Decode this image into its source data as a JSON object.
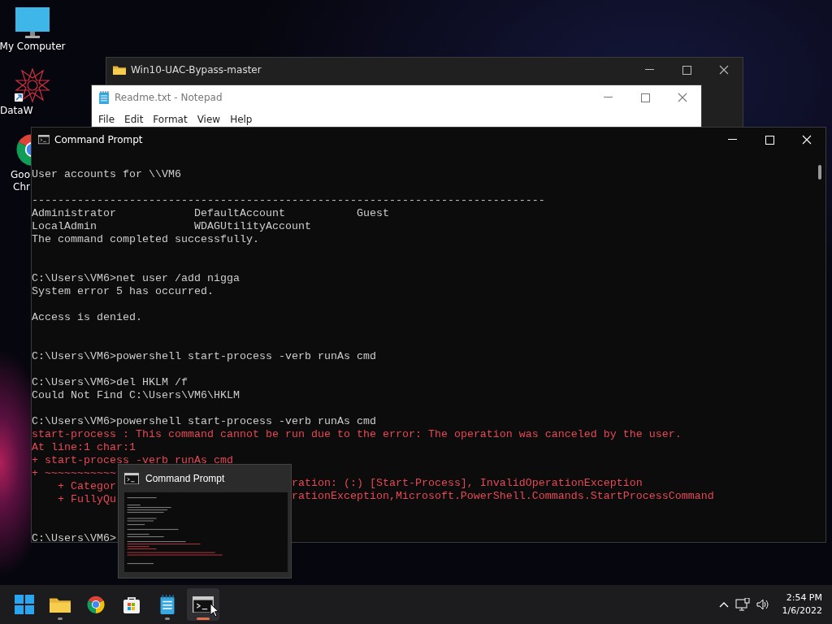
{
  "desktop_icons": [
    {
      "kind": "computer",
      "lines": [
        "My Computer"
      ]
    },
    {
      "kind": "star",
      "lines": [
        "DataW"
      ]
    },
    {
      "kind": "chrome",
      "lines": [
        "Goo",
        "Chr"
      ]
    }
  ],
  "explorer_window": {
    "title": "Win10-UAC-Bypass-master"
  },
  "notepad_window": {
    "title": "Readme.txt - Notepad",
    "menu": [
      "File",
      "Edit",
      "Format",
      "View",
      "Help"
    ]
  },
  "console_window": {
    "title": "Command Prompt",
    "lines": [
      {
        "kind": "normal",
        "segments": [
          "User accounts for \\\\VM6"
        ]
      },
      {
        "kind": "blank"
      },
      {
        "kind": "normal",
        "segments": [
          "-------------------------------------------------------------------------------"
        ]
      },
      {
        "kind": "normal",
        "segments": [
          "Administrator            DefaultAccount           Guest"
        ]
      },
      {
        "kind": "normal",
        "segments": [
          "LocalAdmin               WDAGUtilityAccount"
        ]
      },
      {
        "kind": "normal",
        "segments": [
          "The command completed successfully."
        ]
      },
      {
        "kind": "blank"
      },
      {
        "kind": "blank"
      },
      {
        "kind": "normal",
        "segments": [
          "C:\\Users\\VM6>net user /add nigga"
        ]
      },
      {
        "kind": "normal",
        "segments": [
          "System error 5 has occurred."
        ]
      },
      {
        "kind": "blank"
      },
      {
        "kind": "normal",
        "segments": [
          "Access is denied."
        ]
      },
      {
        "kind": "blank"
      },
      {
        "kind": "blank"
      },
      {
        "kind": "normal",
        "segments": [
          "C:\\Users\\VM6>powershell start-process -verb runAs cmd"
        ]
      },
      {
        "kind": "blank"
      },
      {
        "kind": "normal",
        "segments": [
          "C:\\Users\\VM6>del HKLM /f"
        ]
      },
      {
        "kind": "normal",
        "segments": [
          "Could Not Find C:\\Users\\VM6\\HKLM"
        ]
      },
      {
        "kind": "blank"
      },
      {
        "kind": "normal",
        "segments": [
          "C:\\Users\\VM6>powershell start-process -verb runAs cmd"
        ]
      },
      {
        "kind": "error",
        "segments": [
          "start-process : This command cannot be run due to the error: The operation was canceled by the user."
        ]
      },
      {
        "kind": "error",
        "segments": [
          "At line:1 char:1"
        ]
      },
      {
        "kind": "error",
        "segments": [
          "+ start-process -verb runAs cmd"
        ]
      },
      {
        "kind": "error",
        "segments": [
          "+ ~~~~~~~~~~~"
        ]
      },
      {
        "kind": "error",
        "segments": [
          "    + Categor",
          "ration: (:) [Start-Process], InvalidOperationException"
        ]
      },
      {
        "kind": "error",
        "segments": [
          "    + FullyQu",
          "rationException,Microsoft.PowerShell.Commands.StartProcessCommand"
        ]
      },
      {
        "kind": "blank"
      },
      {
        "kind": "blank"
      },
      {
        "kind": "normal",
        "segments": [
          "C:\\Users\\VM6>"
        ]
      }
    ]
  },
  "preview_popup": {
    "title": "Command Prompt"
  },
  "taskbar": {
    "items": [
      {
        "kind": "start",
        "running": false,
        "selected": false
      },
      {
        "kind": "folder",
        "running": true,
        "selected": false
      },
      {
        "kind": "chrome",
        "running": false,
        "selected": false
      },
      {
        "kind": "store",
        "running": false,
        "selected": false
      },
      {
        "kind": "notepad",
        "running": true,
        "selected": false
      },
      {
        "kind": "console",
        "running": true,
        "selected": true
      }
    ],
    "time": "2:54 PM",
    "date": "1/6/2022"
  }
}
